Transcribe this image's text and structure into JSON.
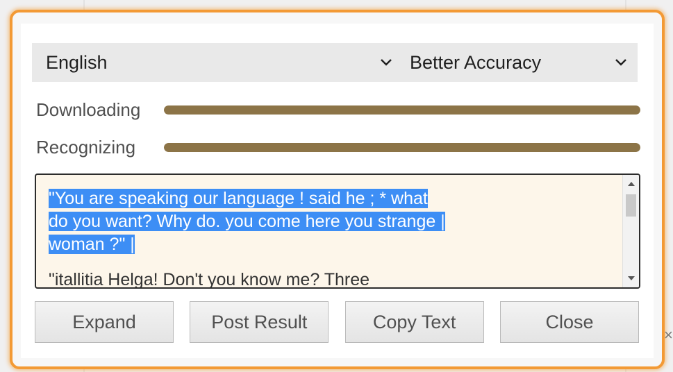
{
  "language": {
    "selected": "English",
    "icon": "chevron-down-icon"
  },
  "mode": {
    "selected": "Better Accuracy",
    "icon": "chevron-down-icon"
  },
  "progress": {
    "downloading": {
      "label": "Downloading",
      "value": 100
    },
    "recognizing": {
      "label": "Recognizing",
      "value": 100
    }
  },
  "result": {
    "selected_lines": [
      "\"You are speaking our language ! said he ; * what",
      "do you want? Why do. you come here you strange |",
      "woman ?\" |"
    ],
    "next_line": "\"itallitia Helga! Don't you know me? Three"
  },
  "buttons": {
    "expand": "Expand",
    "post_result": "Post Result",
    "copy_text": "Copy Text",
    "close": "Close"
  },
  "colors": {
    "accent_border": "#f39a35",
    "progress_fill": "#8c7447",
    "selection": "#3d8ef5",
    "text_bg": "#fdf6ea"
  }
}
